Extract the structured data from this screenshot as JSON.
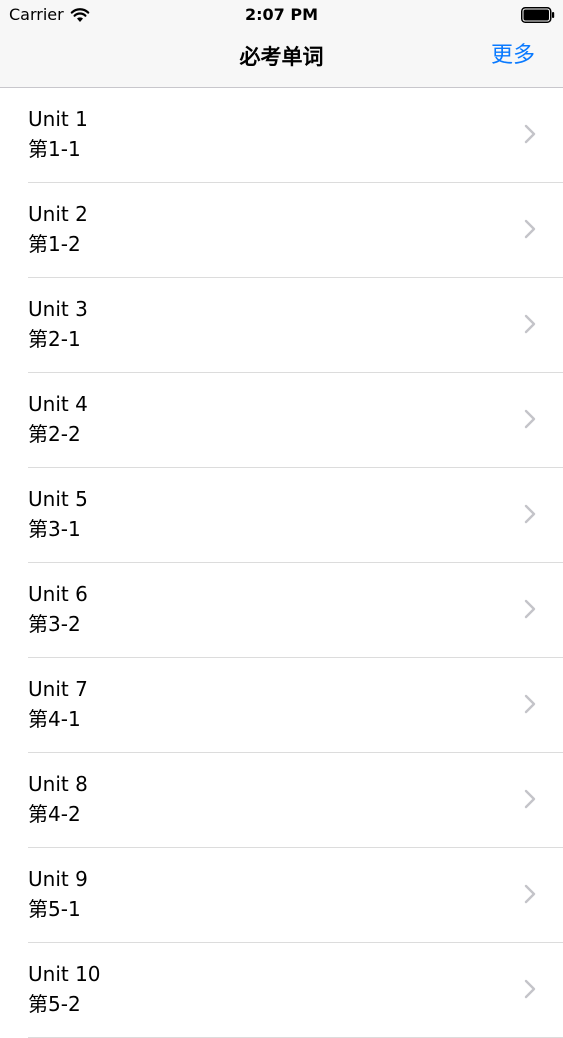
{
  "status_bar": {
    "carrier": "Carrier",
    "time": "2:07 PM",
    "icons": [
      "wifi-icon",
      "battery-icon"
    ]
  },
  "nav_bar": {
    "title": "必考单词",
    "right_button": "更多",
    "accent_color": "#0a7aff"
  },
  "list": {
    "items": [
      {
        "title": "Unit 1",
        "subtitle": "第1-1"
      },
      {
        "title": "Unit 2",
        "subtitle": "第1-2"
      },
      {
        "title": "Unit 3",
        "subtitle": "第2-1"
      },
      {
        "title": "Unit 4",
        "subtitle": "第2-2"
      },
      {
        "title": "Unit 5",
        "subtitle": "第3-1"
      },
      {
        "title": "Unit 6",
        "subtitle": "第3-2"
      },
      {
        "title": "Unit 7",
        "subtitle": "第4-1"
      },
      {
        "title": "Unit 8",
        "subtitle": "第4-2"
      },
      {
        "title": "Unit 9",
        "subtitle": "第5-1"
      },
      {
        "title": "Unit 10",
        "subtitle": "第5-2"
      }
    ],
    "accessory_icon": "chevron-right-icon"
  }
}
